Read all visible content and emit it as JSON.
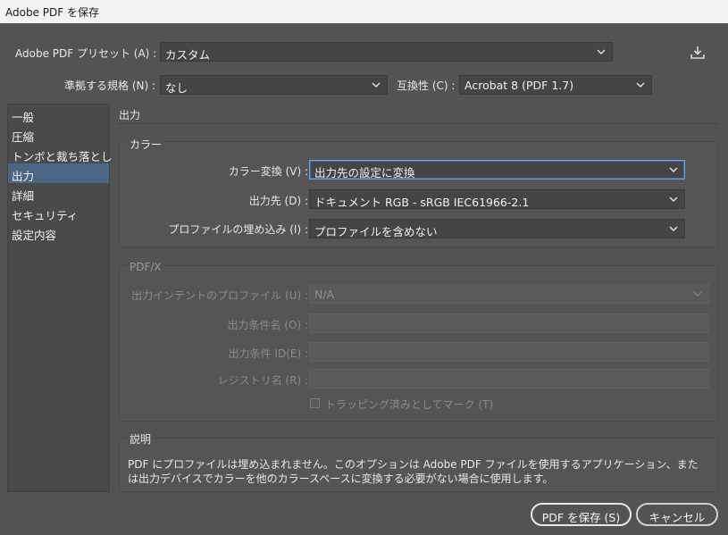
{
  "window": {
    "title": "Adobe PDF を保存"
  },
  "top": {
    "preset_label": "Adobe PDF プリセット (A) :",
    "preset_value": "カスタム",
    "standard_label": "準拠する規格 (N) :",
    "standard_value": "なし",
    "compat_label": "互換性 (C) :",
    "compat_value": "Acrobat 8 (PDF 1.7)"
  },
  "sidebar": {
    "items": [
      {
        "label": "一般"
      },
      {
        "label": "圧縮"
      },
      {
        "label": "トンボと裁ち落とし"
      },
      {
        "label": "出力",
        "selected": true
      },
      {
        "label": "詳細"
      },
      {
        "label": "セキュリティ"
      },
      {
        "label": "設定内容"
      }
    ]
  },
  "main": {
    "section_title": "出力",
    "color": {
      "title": "カラー",
      "conversion_label": "カラー変換 (V) :",
      "conversion_value": "出力先の設定に変換",
      "destination_label": "出力先 (D) :",
      "destination_value": "ドキュメント RGB - sRGB IEC61966-2.1",
      "profile_label": "プロファイルの埋め込み (I) :",
      "profile_value": "プロファイルを含めない"
    },
    "pdfx": {
      "title": "PDF/X",
      "intent_label": "出力インテントのプロファイル (U) :",
      "intent_value": "N/A",
      "condition_name_label": "出力条件名 (O) :",
      "condition_id_label": "出力条件 ID(E) :",
      "registry_label": "レジストリ名 (R) :",
      "trapped_label": "トラッピング済みとしてマーク (T)"
    },
    "description": {
      "title": "説明",
      "line1": "PDF にプロファイルは埋め込まれません。このオプションは Adobe PDF ファイルを使用するアプリケーション、また",
      "line2": "は出力デバイスでカラーを他のカラースペースに変換する必要がない場合に使用します。"
    }
  },
  "buttons": {
    "save_label": "PDF を保存 (S)",
    "cancel_label": "キャンセル"
  }
}
